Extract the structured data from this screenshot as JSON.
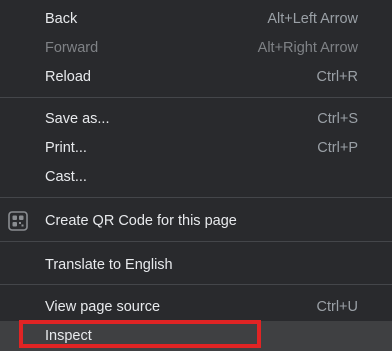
{
  "menu": {
    "back": {
      "label": "Back",
      "shortcut": "Alt+Left Arrow"
    },
    "forward": {
      "label": "Forward",
      "shortcut": "Alt+Right Arrow"
    },
    "reload": {
      "label": "Reload",
      "shortcut": "Ctrl+R"
    },
    "save_as": {
      "label": "Save as...",
      "shortcut": "Ctrl+S"
    },
    "print": {
      "label": "Print...",
      "shortcut": "Ctrl+P"
    },
    "cast": {
      "label": "Cast..."
    },
    "qr_code": {
      "label": "Create QR Code for this page",
      "icon": "qr-code-icon"
    },
    "translate": {
      "label": "Translate to English"
    },
    "view_source": {
      "label": "View page source",
      "shortcut": "Ctrl+U"
    },
    "inspect": {
      "label": "Inspect"
    }
  },
  "colors": {
    "background": "#292a2d",
    "text": "#e8eaed",
    "disabled_text": "#7f8286",
    "highlight": "#3f4042",
    "annotation_outline": "#e02424"
  }
}
